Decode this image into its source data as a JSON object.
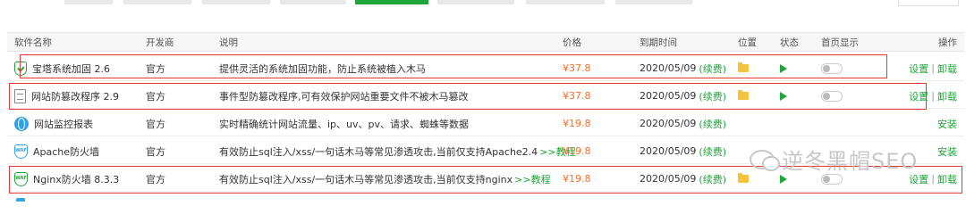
{
  "header": {
    "name": "软件名称",
    "developer": "开发商",
    "description": "说明",
    "price": "价格",
    "expire": "到期时间",
    "position": "位置",
    "status": "状态",
    "homepage": "首页显示",
    "operation": "操作"
  },
  "rows": [
    {
      "icon": "shield-check-icon",
      "name": "宝塔系统加固 2.6",
      "developer": "官方",
      "description": "提供灵活的系统加固功能，防止系统被植入木马",
      "tutorial": "",
      "price": "¥37.8",
      "expire": "2020/05/09",
      "renew": "(续费)",
      "has_folder": true,
      "has_play": true,
      "has_toggle": true,
      "ops": [
        "设置",
        "卸载"
      ],
      "ops_sep": "|"
    },
    {
      "icon": "document-icon",
      "name": "网站防篡改程序 2.9",
      "developer": "官方",
      "description": "事件型防篡改程序,可有效保护网站重要文件不被木马篡改",
      "tutorial": "",
      "price": "¥37.8",
      "expire": "2020/05/09",
      "renew": "(续费)",
      "has_folder": true,
      "has_play": true,
      "has_toggle": true,
      "ops": [
        "设置",
        "卸载"
      ],
      "ops_sep": "|"
    },
    {
      "icon": "globe-icon",
      "name": "网站监控报表",
      "developer": "官方",
      "description": "实时精确统计网站流量、ip、uv、pv、请求、蜘蛛等数据",
      "tutorial": "",
      "price": "¥19.8",
      "expire": "2020/05/09",
      "renew": "(续费)",
      "has_folder": false,
      "has_play": false,
      "has_toggle": false,
      "ops": [
        "安装"
      ],
      "ops_sep": ""
    },
    {
      "icon": "waf-icon",
      "name": "Apache防火墙",
      "developer": "官方",
      "description": "有效防止sql注入/xss/一句话木马等常见渗透攻击,当前仅支持Apache2.4",
      "tutorial": ">>教程",
      "price": "¥19.8",
      "expire": "2020/05/09",
      "renew": "(续费)",
      "has_folder": false,
      "has_play": false,
      "has_toggle": false,
      "ops": [
        "安装"
      ],
      "ops_sep": ""
    },
    {
      "icon": "waf-icon",
      "name": "Nginx防火墙 8.3.3",
      "developer": "官方",
      "description": "有效防止sql注入/xss/一句话木马等常见渗透攻击,当前仅支持nginx",
      "tutorial": ">>教程",
      "price": "¥19.8",
      "expire": "2020/05/09",
      "renew": "(续费)",
      "has_folder": true,
      "has_play": true,
      "has_toggle": true,
      "ops": [
        "设置",
        "卸载"
      ],
      "ops_sep": "|"
    }
  ],
  "watermark": {
    "text": "逆冬黑帽SEO",
    "icon": "wechat-icon"
  },
  "colors": {
    "accent": "#20a53a",
    "price": "#fc6d26",
    "highlight_box": "#e53935"
  }
}
